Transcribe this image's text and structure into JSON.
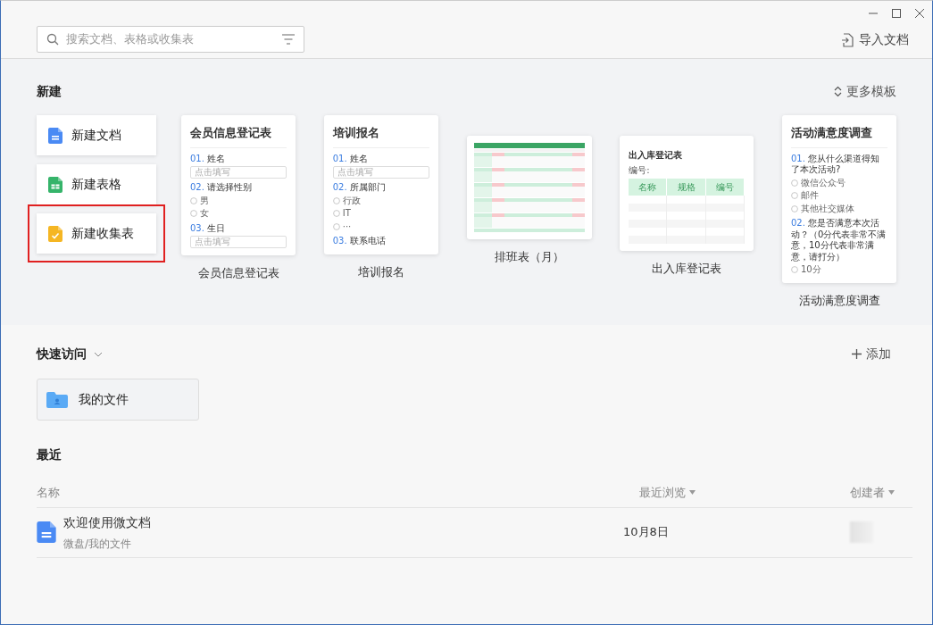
{
  "search": {
    "placeholder": "搜索文档、表格或收集表"
  },
  "import_button": {
    "label": "导入文档"
  },
  "new_section": {
    "title": "新建",
    "more_templates": "更多模板",
    "create_buttons": [
      {
        "label": "新建文档",
        "kind": "doc",
        "highlighted": false
      },
      {
        "label": "新建表格",
        "kind": "sheet",
        "highlighted": false
      },
      {
        "label": "新建收集表",
        "kind": "collect",
        "highlighted": true
      }
    ],
    "templates": [
      {
        "name": "会员信息登记表",
        "kind": "form",
        "preview": {
          "title": "会员信息登记表",
          "questions": [
            {
              "number": "01.",
              "text": "姓名",
              "placeholder": "点击填写"
            },
            {
              "number": "02.",
              "text": "请选择性别",
              "options": [
                "男",
                "女"
              ]
            },
            {
              "number": "03.",
              "text": "生日",
              "placeholder": "点击填写"
            }
          ]
        }
      },
      {
        "name": "培训报名",
        "kind": "form",
        "preview": {
          "title": "培训报名",
          "questions": [
            {
              "number": "01.",
              "text": "姓名",
              "placeholder": "点击填写"
            },
            {
              "number": "02.",
              "text": "所属部门",
              "options": [
                "行政",
                "IT",
                "···"
              ]
            },
            {
              "number": "03.",
              "text": "联系电话"
            }
          ]
        }
      },
      {
        "name": "排班表（月）",
        "kind": "schedule"
      },
      {
        "name": "出入库登记表",
        "kind": "table",
        "preview": {
          "title": "出入库登记表",
          "subtitle": "编号:",
          "columns": [
            "名称",
            "规格",
            "编号"
          ]
        }
      },
      {
        "name": "活动满意度调查",
        "kind": "form",
        "preview": {
          "title": "活动满意度调查",
          "questions": [
            {
              "number": "01.",
              "text": "您从什么渠道得知了本次活动?",
              "options": [
                "微信公众号",
                "邮件",
                "其他社交媒体"
              ]
            },
            {
              "number": "02.",
              "text": "您是否满意本次活动？（0分代表非常不满意，10分代表非常满意，请打分）",
              "options": [
                "10分"
              ]
            }
          ]
        }
      }
    ]
  },
  "quick_access": {
    "title": "快速访问",
    "expanded": true,
    "add_label": "添加",
    "items": [
      {
        "label": "我的文件"
      }
    ]
  },
  "recent": {
    "title": "最近",
    "columns": [
      {
        "label": "名称",
        "sortable": false
      },
      {
        "label": "最近浏览",
        "sortable": true
      },
      {
        "label": "创建者",
        "sortable": true
      }
    ],
    "rows": [
      {
        "title": "欢迎使用微文档",
        "path": "微盘/我的文件",
        "viewed": "10月8日",
        "kind": "doc"
      }
    ]
  }
}
